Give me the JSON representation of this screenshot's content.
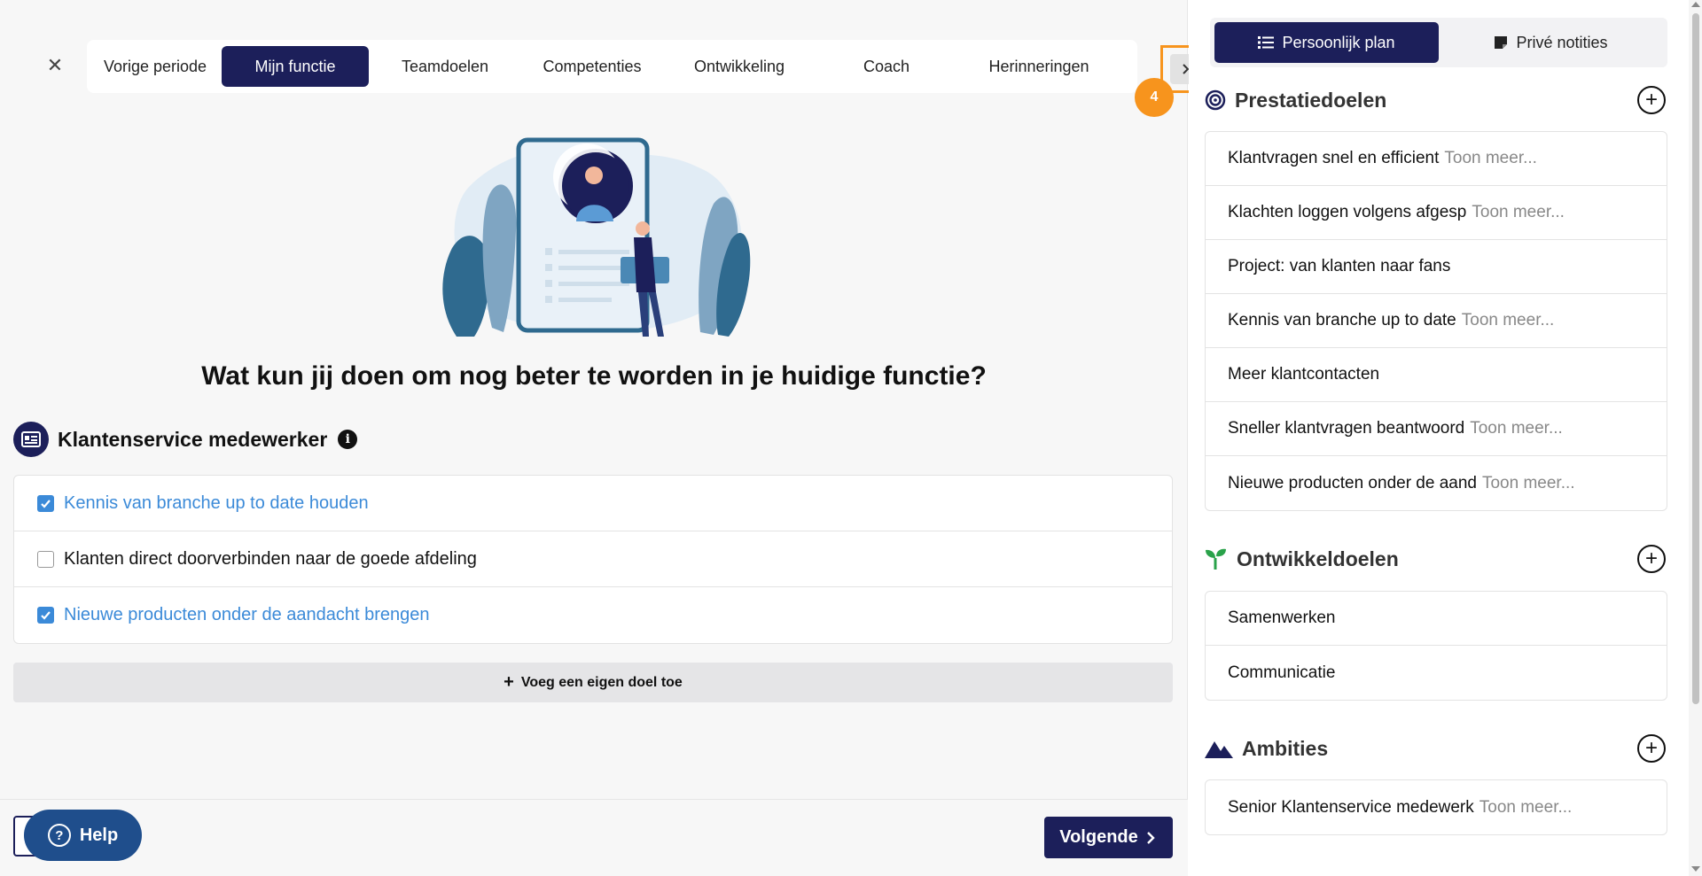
{
  "tabs": [
    {
      "label": "Vorige periode",
      "active": false
    },
    {
      "label": "Mijn functie",
      "active": true
    },
    {
      "label": "Teamdoelen",
      "active": false
    },
    {
      "label": "Competenties",
      "active": false
    },
    {
      "label": "Ontwikkeling",
      "active": false
    },
    {
      "label": "Coach",
      "active": false
    },
    {
      "label": "Herinneringen",
      "active": false
    }
  ],
  "step_badge": "4",
  "question": "Wat kun jij doen om nog beter te worden in je huidige functie?",
  "role": {
    "title": "Klantenservice medewerker",
    "info": "i"
  },
  "goals": [
    {
      "label": "Kennis van branche up to date houden",
      "checked": true
    },
    {
      "label": "Klanten direct doorverbinden naar de goede afdeling",
      "checked": false
    },
    {
      "label": "Nieuwe producten onder de aandacht brengen",
      "checked": true
    }
  ],
  "add_goal_label": "Voeg een eigen doel toe",
  "help_label": "Help",
  "next_label": "Volgende",
  "segments": {
    "plan": "Persoonlijk plan",
    "notes": "Privé notities"
  },
  "sections": {
    "prestatie": {
      "title": "Prestatiedoelen",
      "items": [
        {
          "text": "Klantvragen snel en efficient",
          "more": "Toon meer..."
        },
        {
          "text": "Klachten loggen volgens afgesp",
          "more": "Toon meer..."
        },
        {
          "text": "Project: van klanten naar fans",
          "more": ""
        },
        {
          "text": "Kennis van branche up to date",
          "more": "Toon meer..."
        },
        {
          "text": "Meer klantcontacten",
          "more": ""
        },
        {
          "text": "Sneller klantvragen beantwoord",
          "more": "Toon meer..."
        },
        {
          "text": "Nieuwe producten onder de aand",
          "more": "Toon meer..."
        }
      ]
    },
    "ontwikkel": {
      "title": "Ontwikkeldoelen",
      "items": [
        {
          "text": "Samenwerken",
          "more": ""
        },
        {
          "text": "Communicatie",
          "more": ""
        }
      ]
    },
    "ambities": {
      "title": "Ambities",
      "items": [
        {
          "text": "Senior Klantenservice medewerk",
          "more": "Toon meer..."
        }
      ]
    }
  },
  "colors": {
    "navy": "#1c1f5a",
    "accent_blue": "#3b8ad8",
    "highlight_orange": "#f7941d"
  }
}
